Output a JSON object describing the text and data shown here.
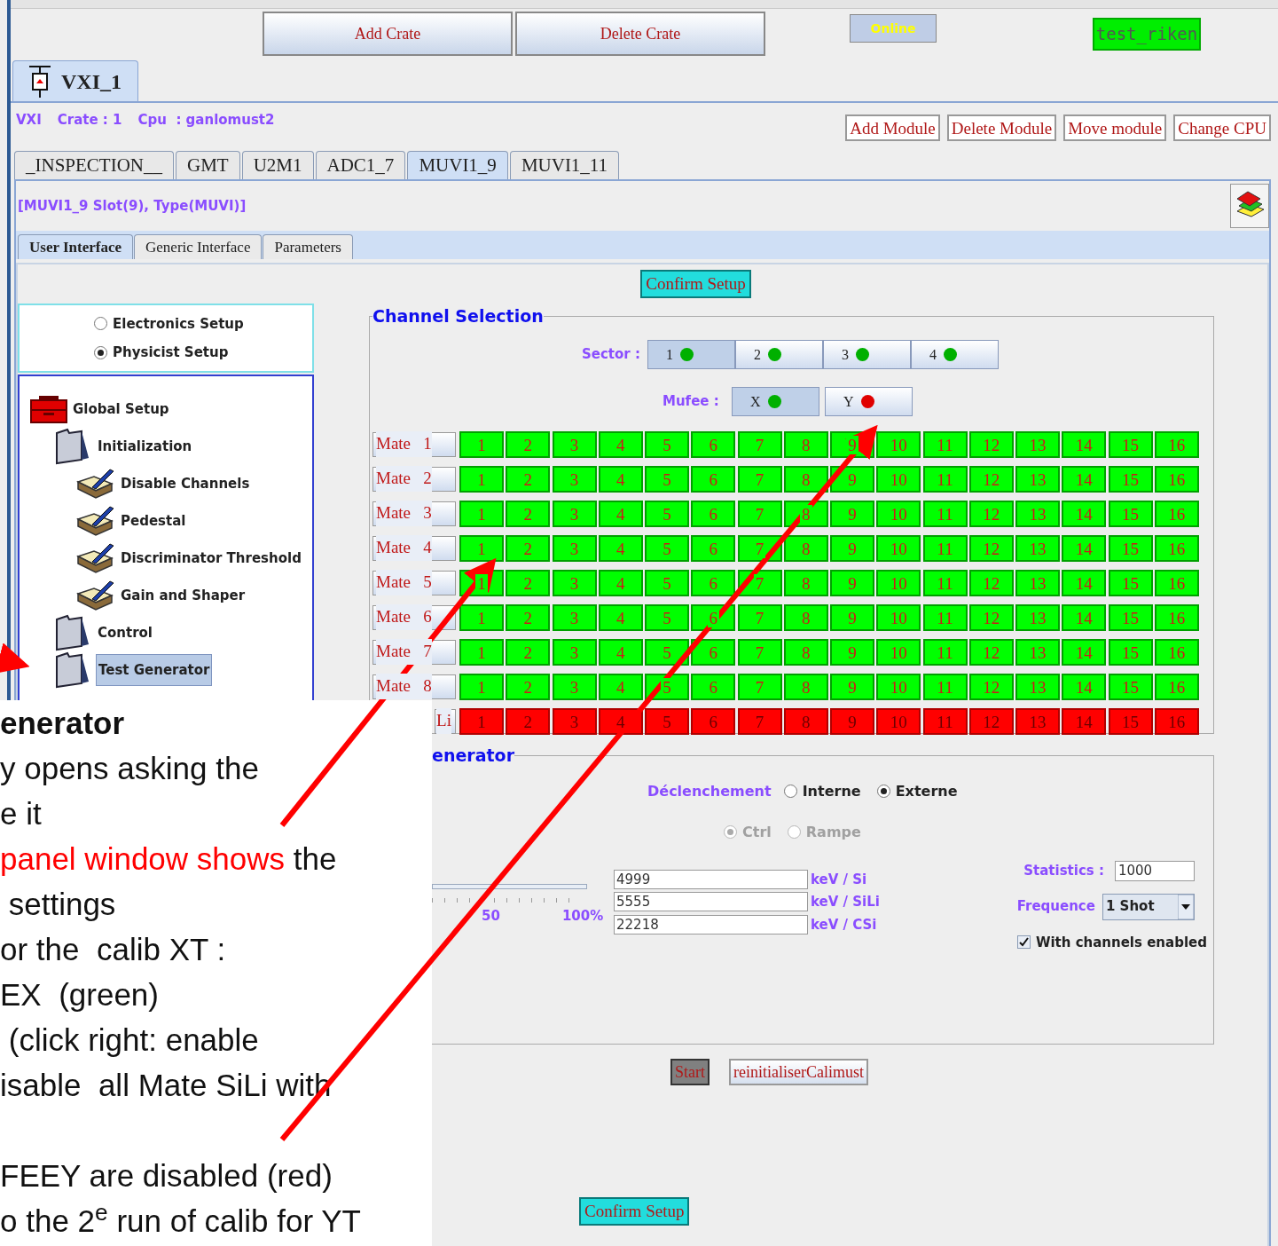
{
  "toolbar": {
    "buttons": [
      "Add Crate",
      "Delete Crate"
    ],
    "status": "Online",
    "config": "test_riken"
  },
  "crate_tab": {
    "label": "VXI_1",
    "selected": true
  },
  "crate_info": {
    "type": "VXI",
    "crate": "Crate : 1",
    "cpu": "Cpu  : ganlomust2"
  },
  "module_buttons": [
    "Add Module",
    "Delete Module",
    "Move module",
    "Change CPU"
  ],
  "module_tabs": [
    {
      "label": "_INSPECTION__",
      "selected": false
    },
    {
      "label": "GMT",
      "selected": false
    },
    {
      "label": "U2M1",
      "selected": false
    },
    {
      "label": "ADC1_7",
      "selected": false
    },
    {
      "label": "MUVI1_9",
      "selected": true
    },
    {
      "label": "MUVI1_11",
      "selected": false
    }
  ],
  "module_info": "[MUVI1_9 Slot(9), Type(MUVI)]",
  "view_tabs": [
    {
      "label": "User Interface",
      "selected": true
    },
    {
      "label": "Generic Interface",
      "selected": false
    },
    {
      "label": "Parameters",
      "selected": false
    }
  ],
  "confirm_top": "Confirm Setup",
  "setup_mode": [
    {
      "label": "Electronics Setup",
      "selected": false
    },
    {
      "label": "Physicist Setup",
      "selected": true
    }
  ],
  "tree": {
    "label": "Global Setup",
    "kind": "toolbox",
    "selected": false,
    "children": [
      {
        "label": "Initialization",
        "kind": "folder",
        "selected": false,
        "children": [
          {
            "label": "Disable Channels",
            "kind": "book",
            "selected": false
          },
          {
            "label": "Pedestal",
            "kind": "book",
            "selected": false
          },
          {
            "label": "Discriminator Threshold",
            "kind": "book",
            "selected": false
          },
          {
            "label": "Gain and Shaper",
            "kind": "book",
            "selected": false
          }
        ]
      },
      {
        "label": "Control",
        "kind": "folder",
        "selected": false
      },
      {
        "label": "Test Generator",
        "kind": "folder",
        "selected": true
      }
    ]
  },
  "channel_selection": {
    "title": "Channel Selection",
    "sector_label": "Sector :",
    "sectors": [
      {
        "label": "1",
        "selected": true,
        "color": "#00b000"
      },
      {
        "label": "2",
        "selected": false,
        "color": "#00b000"
      },
      {
        "label": "3",
        "selected": false,
        "color": "#00b000"
      },
      {
        "label": "4",
        "selected": false,
        "color": "#00b000"
      }
    ],
    "mufee_label": "Mufee :",
    "mufee": [
      {
        "label": "X",
        "selected": true,
        "color": "#00b000"
      },
      {
        "label": "Y",
        "selected": false,
        "color": "#e00000"
      }
    ],
    "rows": [
      {
        "label": "Mate   1",
        "enabled": true,
        "channels": [
          "1",
          "2",
          "3",
          "4",
          "5",
          "6",
          "7",
          "8",
          "9",
          "10",
          "11",
          "12",
          "13",
          "14",
          "15",
          "16"
        ]
      },
      {
        "label": "Mate   2",
        "enabled": true,
        "channels": [
          "1",
          "2",
          "3",
          "4",
          "5",
          "6",
          "7",
          "8",
          "9",
          "10",
          "11",
          "12",
          "13",
          "14",
          "15",
          "16"
        ]
      },
      {
        "label": "Mate   3",
        "enabled": true,
        "channels": [
          "1",
          "2",
          "3",
          "4",
          "5",
          "6",
          "7",
          "8",
          "9",
          "10",
          "11",
          "12",
          "13",
          "14",
          "15",
          "16"
        ]
      },
      {
        "label": "Mate   4",
        "enabled": true,
        "channels": [
          "1",
          "2",
          "3",
          "4",
          "5",
          "6",
          "7",
          "8",
          "9",
          "10",
          "11",
          "12",
          "13",
          "14",
          "15",
          "16"
        ]
      },
      {
        "label": "Mate   5",
        "enabled": true,
        "channels": [
          "1",
          "2",
          "3",
          "4",
          "5",
          "6",
          "7",
          "8",
          "9",
          "10",
          "11",
          "12",
          "13",
          "14",
          "15",
          "16"
        ]
      },
      {
        "label": "Mate   6",
        "enabled": true,
        "channels": [
          "1",
          "2",
          "3",
          "4",
          "5",
          "6",
          "7",
          "8",
          "9",
          "10",
          "11",
          "12",
          "13",
          "14",
          "15",
          "16"
        ]
      },
      {
        "label": "Mate   7",
        "enabled": true,
        "channels": [
          "1",
          "2",
          "3",
          "4",
          "5",
          "6",
          "7",
          "8",
          "9",
          "10",
          "11",
          "12",
          "13",
          "14",
          "15",
          "16"
        ]
      },
      {
        "label": "Mate   8",
        "enabled": true,
        "channels": [
          "1",
          "2",
          "3",
          "4",
          "5",
          "6",
          "7",
          "8",
          "9",
          "10",
          "11",
          "12",
          "13",
          "14",
          "15",
          "16"
        ]
      },
      {
        "label": "Li",
        "enabled": false,
        "channels": [
          "1",
          "2",
          "3",
          "4",
          "5",
          "6",
          "7",
          "8",
          "9",
          "10",
          "11",
          "12",
          "13",
          "14",
          "15",
          "16"
        ]
      }
    ]
  },
  "test_generator": {
    "title": "enerator",
    "trigger_label": "Déclenchement",
    "trigger": [
      {
        "label": "Interne",
        "selected": false
      },
      {
        "label": "Externe",
        "selected": true
      }
    ],
    "mode_disabled": true,
    "mode": [
      {
        "label": "Ctrl",
        "selected": true
      },
      {
        "label": "Rampe",
        "selected": false
      }
    ],
    "slider_ticks": [
      "50",
      "100%"
    ],
    "energies": [
      {
        "value": "4999",
        "unit": "keV / Si"
      },
      {
        "value": "5555",
        "unit": "keV / SiLi"
      },
      {
        "value": "22218",
        "unit": "keV / CSi"
      }
    ],
    "statistics_label": "Statistics :",
    "statistics": "1000",
    "frequence_label": "Frequence",
    "frequence": "1 Shot",
    "with_channels": {
      "label": "With channels enabled",
      "checked": true
    }
  },
  "actions": [
    {
      "label": "Start",
      "kind": "pressed"
    },
    {
      "label": "reinitialiserCalimust",
      "kind": "normal"
    }
  ],
  "confirm_bottom": "Confirm Setup",
  "note": {
    "lines": [
      {
        "text": "enerator",
        "bold": true,
        "gap_before": false
      },
      {
        "text": "y opens asking the",
        "bold": false,
        "gap_before": false
      },
      {
        "text": "e it",
        "bold": false,
        "gap_before": false
      },
      {
        "text": "the",
        "highlight": "panel window shows",
        "bold": false,
        "gap_before": false
      },
      {
        "text": " settings",
        "bold": false,
        "gap_before": false
      },
      {
        "text": "or the  calib XT :",
        "bold": false,
        "gap_before": false
      },
      {
        "text": "EX  (green)",
        "bold": false,
        "gap_before": false
      },
      {
        "text": " (click right: enable",
        "bold": false,
        "gap_before": false
      },
      {
        "text": "isable  all Mate SiLi with",
        "bold": false,
        "gap_before": false
      },
      {
        "text": "FEEY are disabled (red)",
        "bold": false,
        "gap_before": true
      },
      {
        "text": "o the 2$^{e}$ run of calib for YT",
        "bold": false,
        "gap_before": false
      }
    ]
  }
}
